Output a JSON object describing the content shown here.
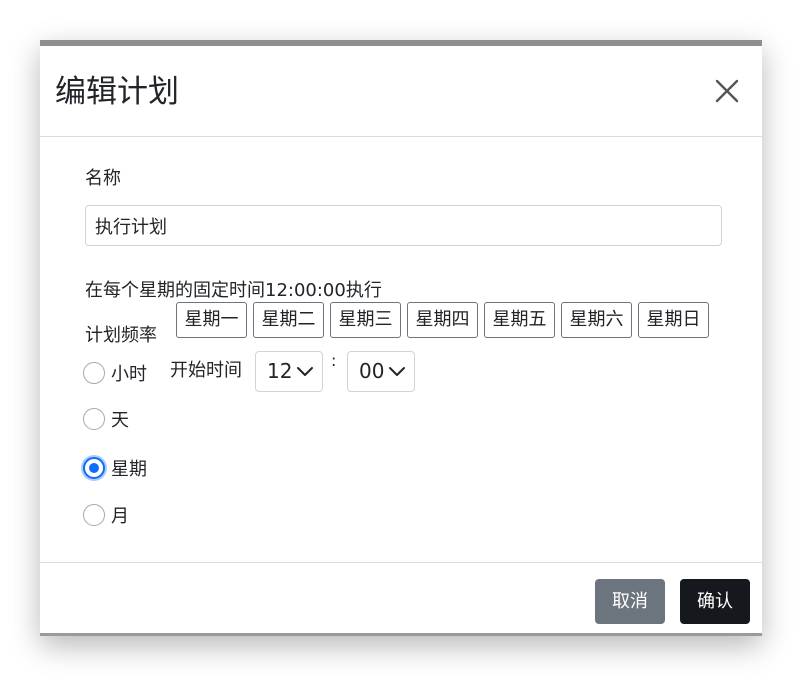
{
  "dialog": {
    "title": "编辑计划",
    "close_icon": "close-icon"
  },
  "form": {
    "name_label": "名称",
    "name_value": "执行计划",
    "summary": "在每个星期的固定时间12:00:00执行",
    "frequency_label": "计划频率",
    "frequency_options": [
      {
        "label": "小时",
        "checked": false
      },
      {
        "label": "天",
        "checked": false
      },
      {
        "label": "星期",
        "checked": true
      },
      {
        "label": "月",
        "checked": false
      }
    ],
    "weekdays": [
      "星期一",
      "星期二",
      "星期三",
      "星期四",
      "星期五",
      "星期六",
      "星期日"
    ],
    "start_time_label": "开始时间",
    "hour_value": "12",
    "time_separator": ":",
    "minute_value": "00"
  },
  "footer": {
    "cancel_label": "取消",
    "confirm_label": "确认"
  },
  "colors": {
    "accent": "#0d6efd",
    "cancel_bg": "#6c757d",
    "confirm_bg": "#15191d"
  }
}
